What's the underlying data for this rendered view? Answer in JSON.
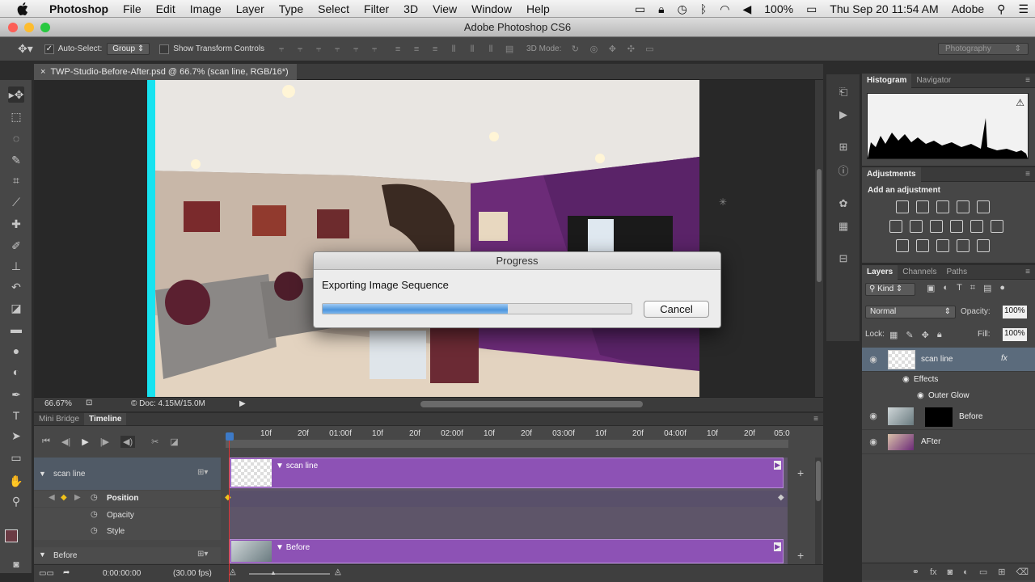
{
  "menubar": {
    "app": "Photoshop",
    "items": [
      "File",
      "Edit",
      "Image",
      "Layer",
      "Type",
      "Select",
      "Filter",
      "3D",
      "View",
      "Window",
      "Help"
    ],
    "battery": "100%",
    "datetime": "Thu Sep 20  11:54 AM",
    "user": "Adobe"
  },
  "window": {
    "title": "Adobe Photoshop CS6"
  },
  "options": {
    "auto_select_label": "Auto-Select:",
    "auto_select_value": "Group",
    "transform_label": "Show Transform Controls",
    "mode3d_label": "3D Mode:",
    "workspace": "Photography"
  },
  "document": {
    "tab": "TWP-Studio-Before-After.psd @ 66.7% (scan line, RGB/16*)"
  },
  "status": {
    "zoom": "66.67%",
    "doc": "Doc: 4.15M/15.0M"
  },
  "panels": {
    "histogram_tabs": [
      "Histogram",
      "Navigator"
    ],
    "adjustments_title": "Adjustments",
    "add_adjustment": "Add an adjustment",
    "layers_tabs": [
      "Layers",
      "Channels",
      "Paths"
    ],
    "filter_kind": "Kind",
    "blend_mode": "Normal",
    "opacity_label": "Opacity:",
    "opacity": "100%",
    "lock_label": "Lock:",
    "fill_label": "Fill:",
    "fill": "100%",
    "layers": [
      "scan line",
      "Before",
      "AFter"
    ],
    "effects_label": "Effects",
    "outer_glow": "Outer Glow"
  },
  "timeline": {
    "tabs": [
      "Mini Bridge",
      "Timeline"
    ],
    "ruler": [
      "10f",
      "20f",
      "01:00f",
      "10f",
      "20f",
      "02:00f",
      "10f",
      "20f",
      "03:00f",
      "10f",
      "20f",
      "04:00f",
      "10f",
      "20f",
      "05:0"
    ],
    "track1": "scan line",
    "props": [
      "Position",
      "Opacity",
      "Style"
    ],
    "track2": "Before",
    "clip1": "scan line",
    "clip2": "Before",
    "timecode": "0:00:00:00",
    "fps": "(30.00 fps)"
  },
  "dialog": {
    "title": "Progress",
    "message": "Exporting Image Sequence",
    "progress": 0.6,
    "cancel": "Cancel"
  },
  "colors": {
    "clip": "#8d52b5",
    "progress": "#4d95dd",
    "scanline": "#17e3f0"
  }
}
